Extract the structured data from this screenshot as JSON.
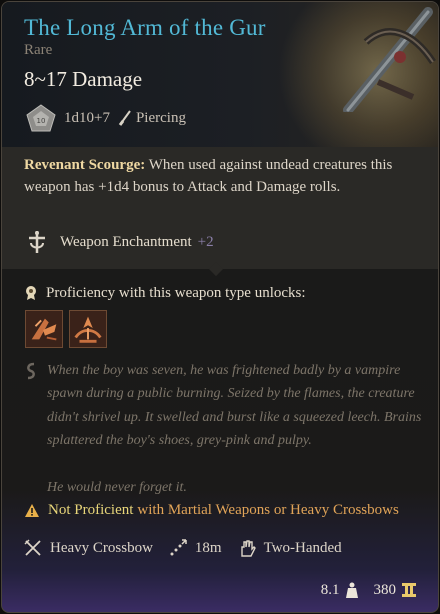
{
  "item": {
    "name": "The Long Arm of the Gur",
    "rarity": "Rare",
    "damage": "8~17 Damage",
    "dice": "1d10+7",
    "damage_type": "Piercing"
  },
  "passive": {
    "name": "Revenant Scourge:",
    "text": " When used against undead creatures this weapon has +1d4 bonus to Attack and Damage rolls."
  },
  "enchantment": {
    "label": "Weapon Enchantment",
    "bonus": "+2"
  },
  "proficiency": {
    "label": "Proficiency with this weapon type unlocks:"
  },
  "lore": {
    "text": "When the boy was seven, he was frightened badly by a vampire spawn during a public burning. Seized by the flames, the creature didn't shrivel up. It swelled and burst like a squeezed leech. Brains splattered the boy's shoes, grey-pink and pulpy.",
    "ending": "He would never forget it."
  },
  "warning": {
    "status": "Not Proficient",
    "detail": "with Martial Weapons or Heavy Crossbows"
  },
  "properties": {
    "type": "Heavy Crossbow",
    "range": "18m",
    "handedness": "Two-Handed"
  },
  "footer": {
    "weight": "8.1",
    "value": "380"
  },
  "colors": {
    "title": "#52b9d6",
    "rarity": "#8c8376",
    "passive_name": "#efd8a2",
    "enchant_bonus": "#8b7fa8",
    "warning_status": "#e8d67a",
    "warning_detail": "#e1a458"
  },
  "icons": [
    "d10-dice-icon",
    "piercing-icon",
    "weapon-enchantment-icon",
    "proficiency-icon",
    "unlock-skill-icon",
    "lore-icon",
    "warning-icon",
    "crossbow-icon",
    "range-icon",
    "two-handed-icon",
    "weight-icon",
    "gold-icon"
  ]
}
